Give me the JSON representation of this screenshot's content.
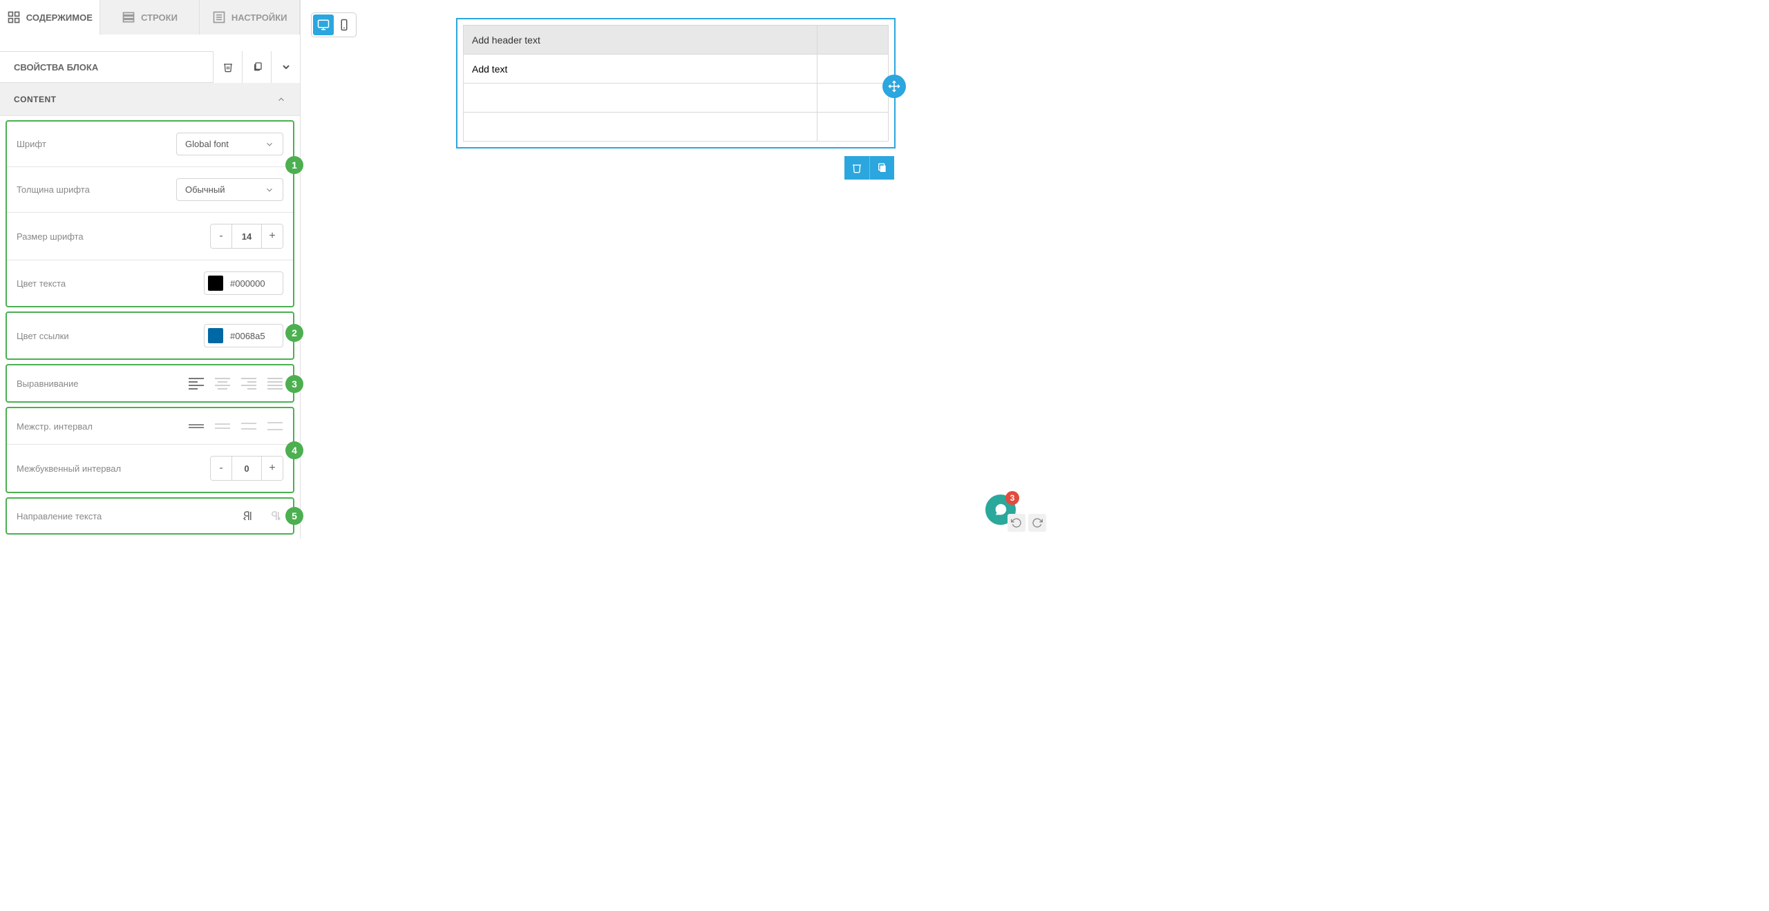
{
  "tabs": {
    "content": "СОДЕРЖИМОЕ",
    "rows": "СТРОКИ",
    "settings": "НАСТРОЙКИ"
  },
  "blockProps": {
    "title": "СВОЙСТВА БЛОКА"
  },
  "section": {
    "content": "CONTENT"
  },
  "props": {
    "font": {
      "label": "Шрифт",
      "value": "Global font"
    },
    "weight": {
      "label": "Толщина шрифта",
      "value": "Обычный"
    },
    "size": {
      "label": "Размер шрифта",
      "value": "14"
    },
    "textColor": {
      "label": "Цвет текста",
      "value": "#000000"
    },
    "linkColor": {
      "label": "Цвет ссылки",
      "value": "#0068a5"
    },
    "align": {
      "label": "Выравнивание"
    },
    "lineHeight": {
      "label": "Межстр. интервал"
    },
    "letterSpacing": {
      "label": "Межбуквенный интервал",
      "value": "0"
    },
    "direction": {
      "label": "Направление текста"
    }
  },
  "annotations": {
    "n1": "1",
    "n2": "2",
    "n3": "3",
    "n4": "4",
    "n5": "5"
  },
  "table": {
    "header": "Add header text",
    "cell": "Add text"
  },
  "fab": {
    "count": "3"
  }
}
